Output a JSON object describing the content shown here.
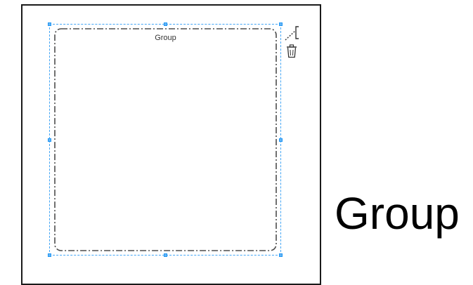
{
  "canvas": {
    "group": {
      "label": "Group",
      "border_color": "#4d4d4d",
      "border_style": "dash-dot",
      "selected": true
    },
    "selection_color": "#42a5f5",
    "toolbar": {
      "connector_icon": "connector-icon",
      "delete_icon": "trash-icon"
    }
  },
  "caption": {
    "text": "Group"
  }
}
